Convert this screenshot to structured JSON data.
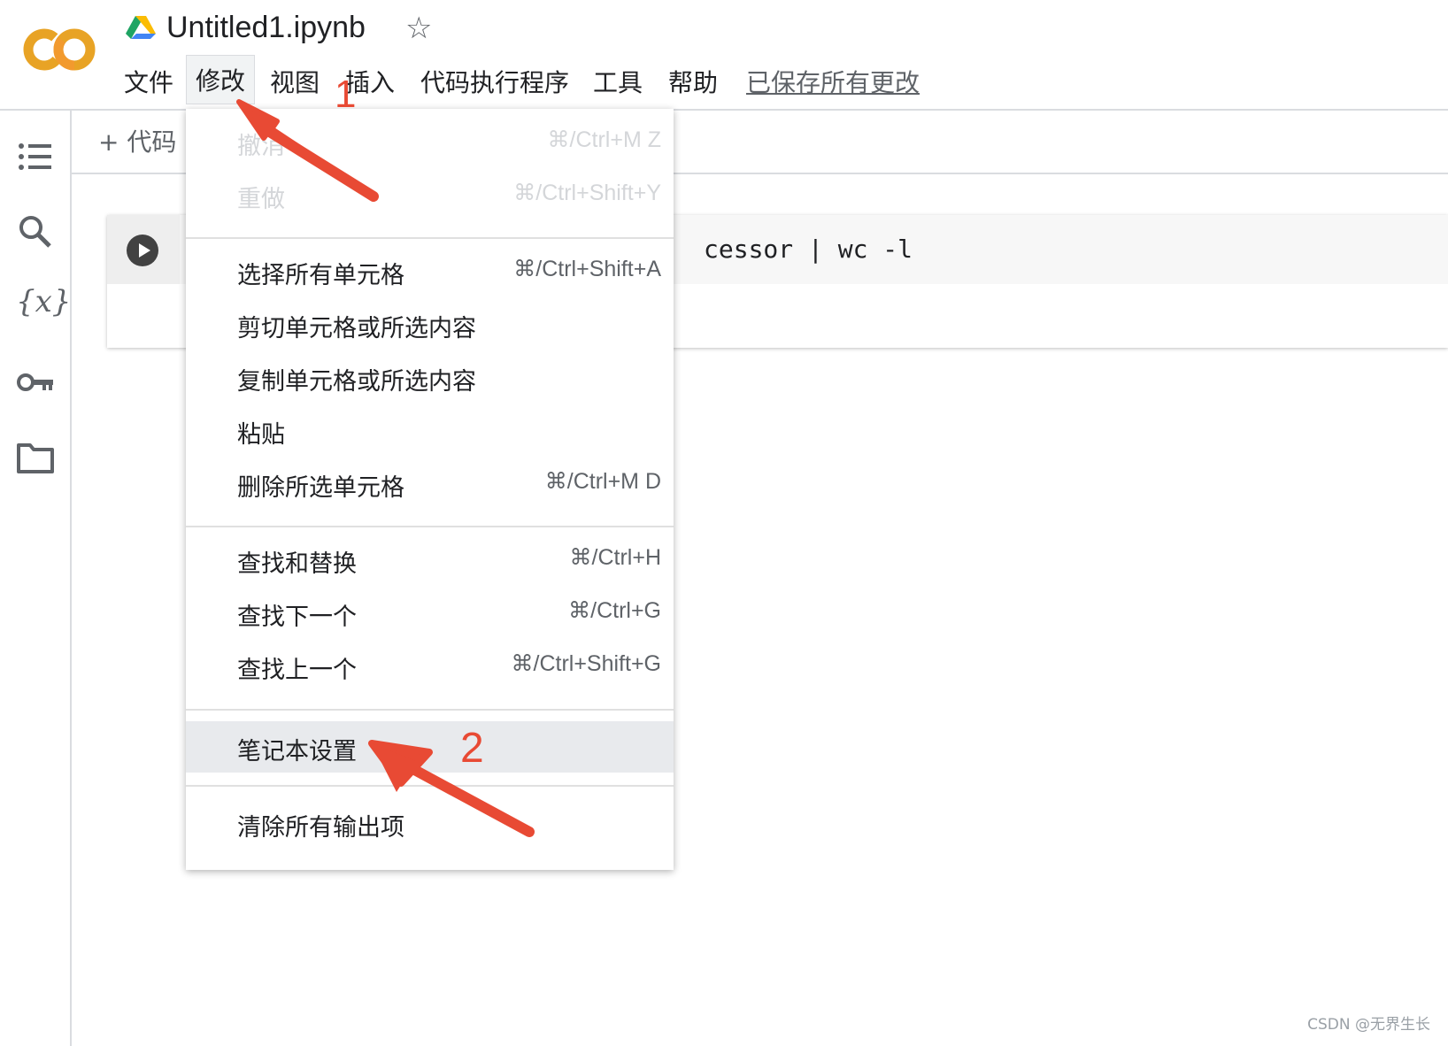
{
  "header": {
    "title": "Untitled1.ipynb",
    "star_icon": "star-outline-icon",
    "logo_text": "CO",
    "menu": [
      "文件",
      "修改",
      "视图",
      "插入",
      "代码执行程序",
      "工具",
      "帮助"
    ],
    "saved_status": "已保存所有更改"
  },
  "toolbar": {
    "add_code_label": "+ 代码"
  },
  "sidebar": {
    "icons": [
      "table-of-contents-icon",
      "search-icon",
      "variables-icon",
      "key-icon",
      "folder-icon"
    ],
    "variables_glyph": "{x}"
  },
  "cell": {
    "code": "cessor | wc -l"
  },
  "edit_menu": {
    "items": [
      {
        "label": "撤消",
        "shortcut": "⌘/Ctrl+M Z",
        "disabled": true
      },
      {
        "label": "重做",
        "shortcut": "⌘/Ctrl+Shift+Y",
        "disabled": true
      },
      {
        "label": "选择所有单元格",
        "shortcut": "⌘/Ctrl+Shift+A"
      },
      {
        "label": "剪切单元格或所选内容",
        "shortcut": ""
      },
      {
        "label": "复制单元格或所选内容",
        "shortcut": ""
      },
      {
        "label": "粘贴",
        "shortcut": ""
      },
      {
        "label": "删除所选单元格",
        "shortcut": "⌘/Ctrl+M D"
      },
      {
        "label": "查找和替换",
        "shortcut": "⌘/Ctrl+H"
      },
      {
        "label": "查找下一个",
        "shortcut": "⌘/Ctrl+G"
      },
      {
        "label": "查找上一个",
        "shortcut": "⌘/Ctrl+Shift+G"
      },
      {
        "label": "笔记本设置",
        "shortcut": "",
        "highlighted": true
      },
      {
        "label": "清除所有输出项",
        "shortcut": ""
      }
    ]
  },
  "annotations": {
    "step1": "1",
    "step2": "2",
    "arrow_color": "#e84a34"
  },
  "watermark": "CSDN @无界生长"
}
